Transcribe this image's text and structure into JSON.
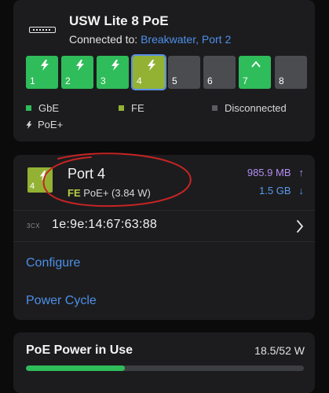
{
  "switch": {
    "name": "USW Lite 8 PoE",
    "connected_prefix": "Connected to:",
    "uplink": "Breakwater, Port 2",
    "ports": [
      {
        "label": "1",
        "state": "gbe",
        "poe": true
      },
      {
        "label": "2",
        "state": "gbe",
        "poe": true
      },
      {
        "label": "3",
        "state": "gbe",
        "poe": true
      },
      {
        "label": "4",
        "state": "fe",
        "poe": true,
        "selected": true
      },
      {
        "label": "5",
        "state": "disconnected",
        "poe": false
      },
      {
        "label": "6",
        "state": "disconnected",
        "poe": false
      },
      {
        "label": "7",
        "state": "gbe",
        "poe": false,
        "uplink": true
      },
      {
        "label": "8",
        "state": "disconnected",
        "poe": false
      }
    ],
    "legend": {
      "gbe": "GbE",
      "fe": "FE",
      "disconnected": "Disconnected",
      "poe": "PoE+"
    }
  },
  "port_detail": {
    "badge": "4",
    "title": "Port 4",
    "speed": "FE",
    "poe": "PoE+ (3.84 W)",
    "tx": "985.9 MB",
    "tx_arrow": "↑",
    "rx": "1.5 GB",
    "rx_arrow": "↓",
    "vendor": "3CX",
    "mac": "1e:9e:14:67:63:88",
    "actions": {
      "configure": "Configure",
      "power_cycle": "Power Cycle"
    }
  },
  "poe_power": {
    "title": "PoE Power in Use",
    "value": "18.5/52 W",
    "used_fraction": 0.356
  },
  "colors": {
    "gbe": "#2fbc5a",
    "fe": "#93b234",
    "disconnected": "#4b4c4f",
    "link": "#4d8fe8",
    "tx": "#b28df0",
    "rx": "#5a9aee",
    "annotation": "#c62424"
  }
}
